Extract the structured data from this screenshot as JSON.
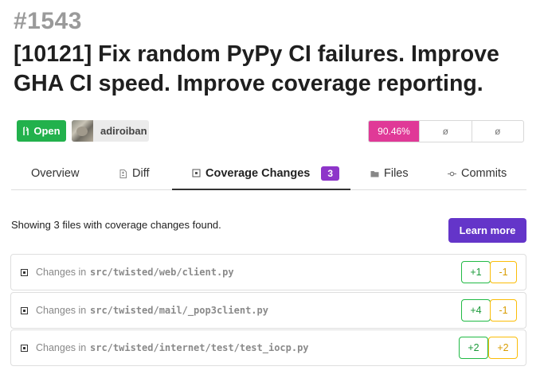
{
  "pr": {
    "number": "#1543",
    "title": "[10121] Fix random PyPy CI failures. Improve GHA CI speed. Improve coverage reporting.",
    "state": "Open",
    "author": "adiroiban"
  },
  "coverage": {
    "percent": "90.46%",
    "cell2": "ø",
    "cell3": "ø",
    "accent": "#e03997"
  },
  "tabs": [
    {
      "label": "Overview",
      "icon": ""
    },
    {
      "label": "Diff",
      "icon": "file-diff-icon"
    },
    {
      "label": "Coverage Changes",
      "icon": "coverage-icon",
      "count": "3",
      "active": true
    },
    {
      "label": "Files",
      "icon": "folder-icon"
    },
    {
      "label": "Commits",
      "icon": "commit-icon"
    }
  ],
  "summary": "Showing 3 files with coverage changes found.",
  "learn_more": "Learn more",
  "files": [
    {
      "label": "Changes in",
      "path": "src/twisted/web/client.py",
      "plus": "+1",
      "minus": "-1"
    },
    {
      "label": "Changes in",
      "path": "src/twisted/mail/_pop3client.py",
      "plus": "+4",
      "minus": "-1"
    },
    {
      "label": "Changes in",
      "path": "src/twisted/internet/test/test_iocp.py",
      "plus": "+2",
      "minus": "+2"
    }
  ],
  "colors": {
    "open": "#22b14c",
    "tab_count": "#8e35c9",
    "button": "#6435c9"
  }
}
